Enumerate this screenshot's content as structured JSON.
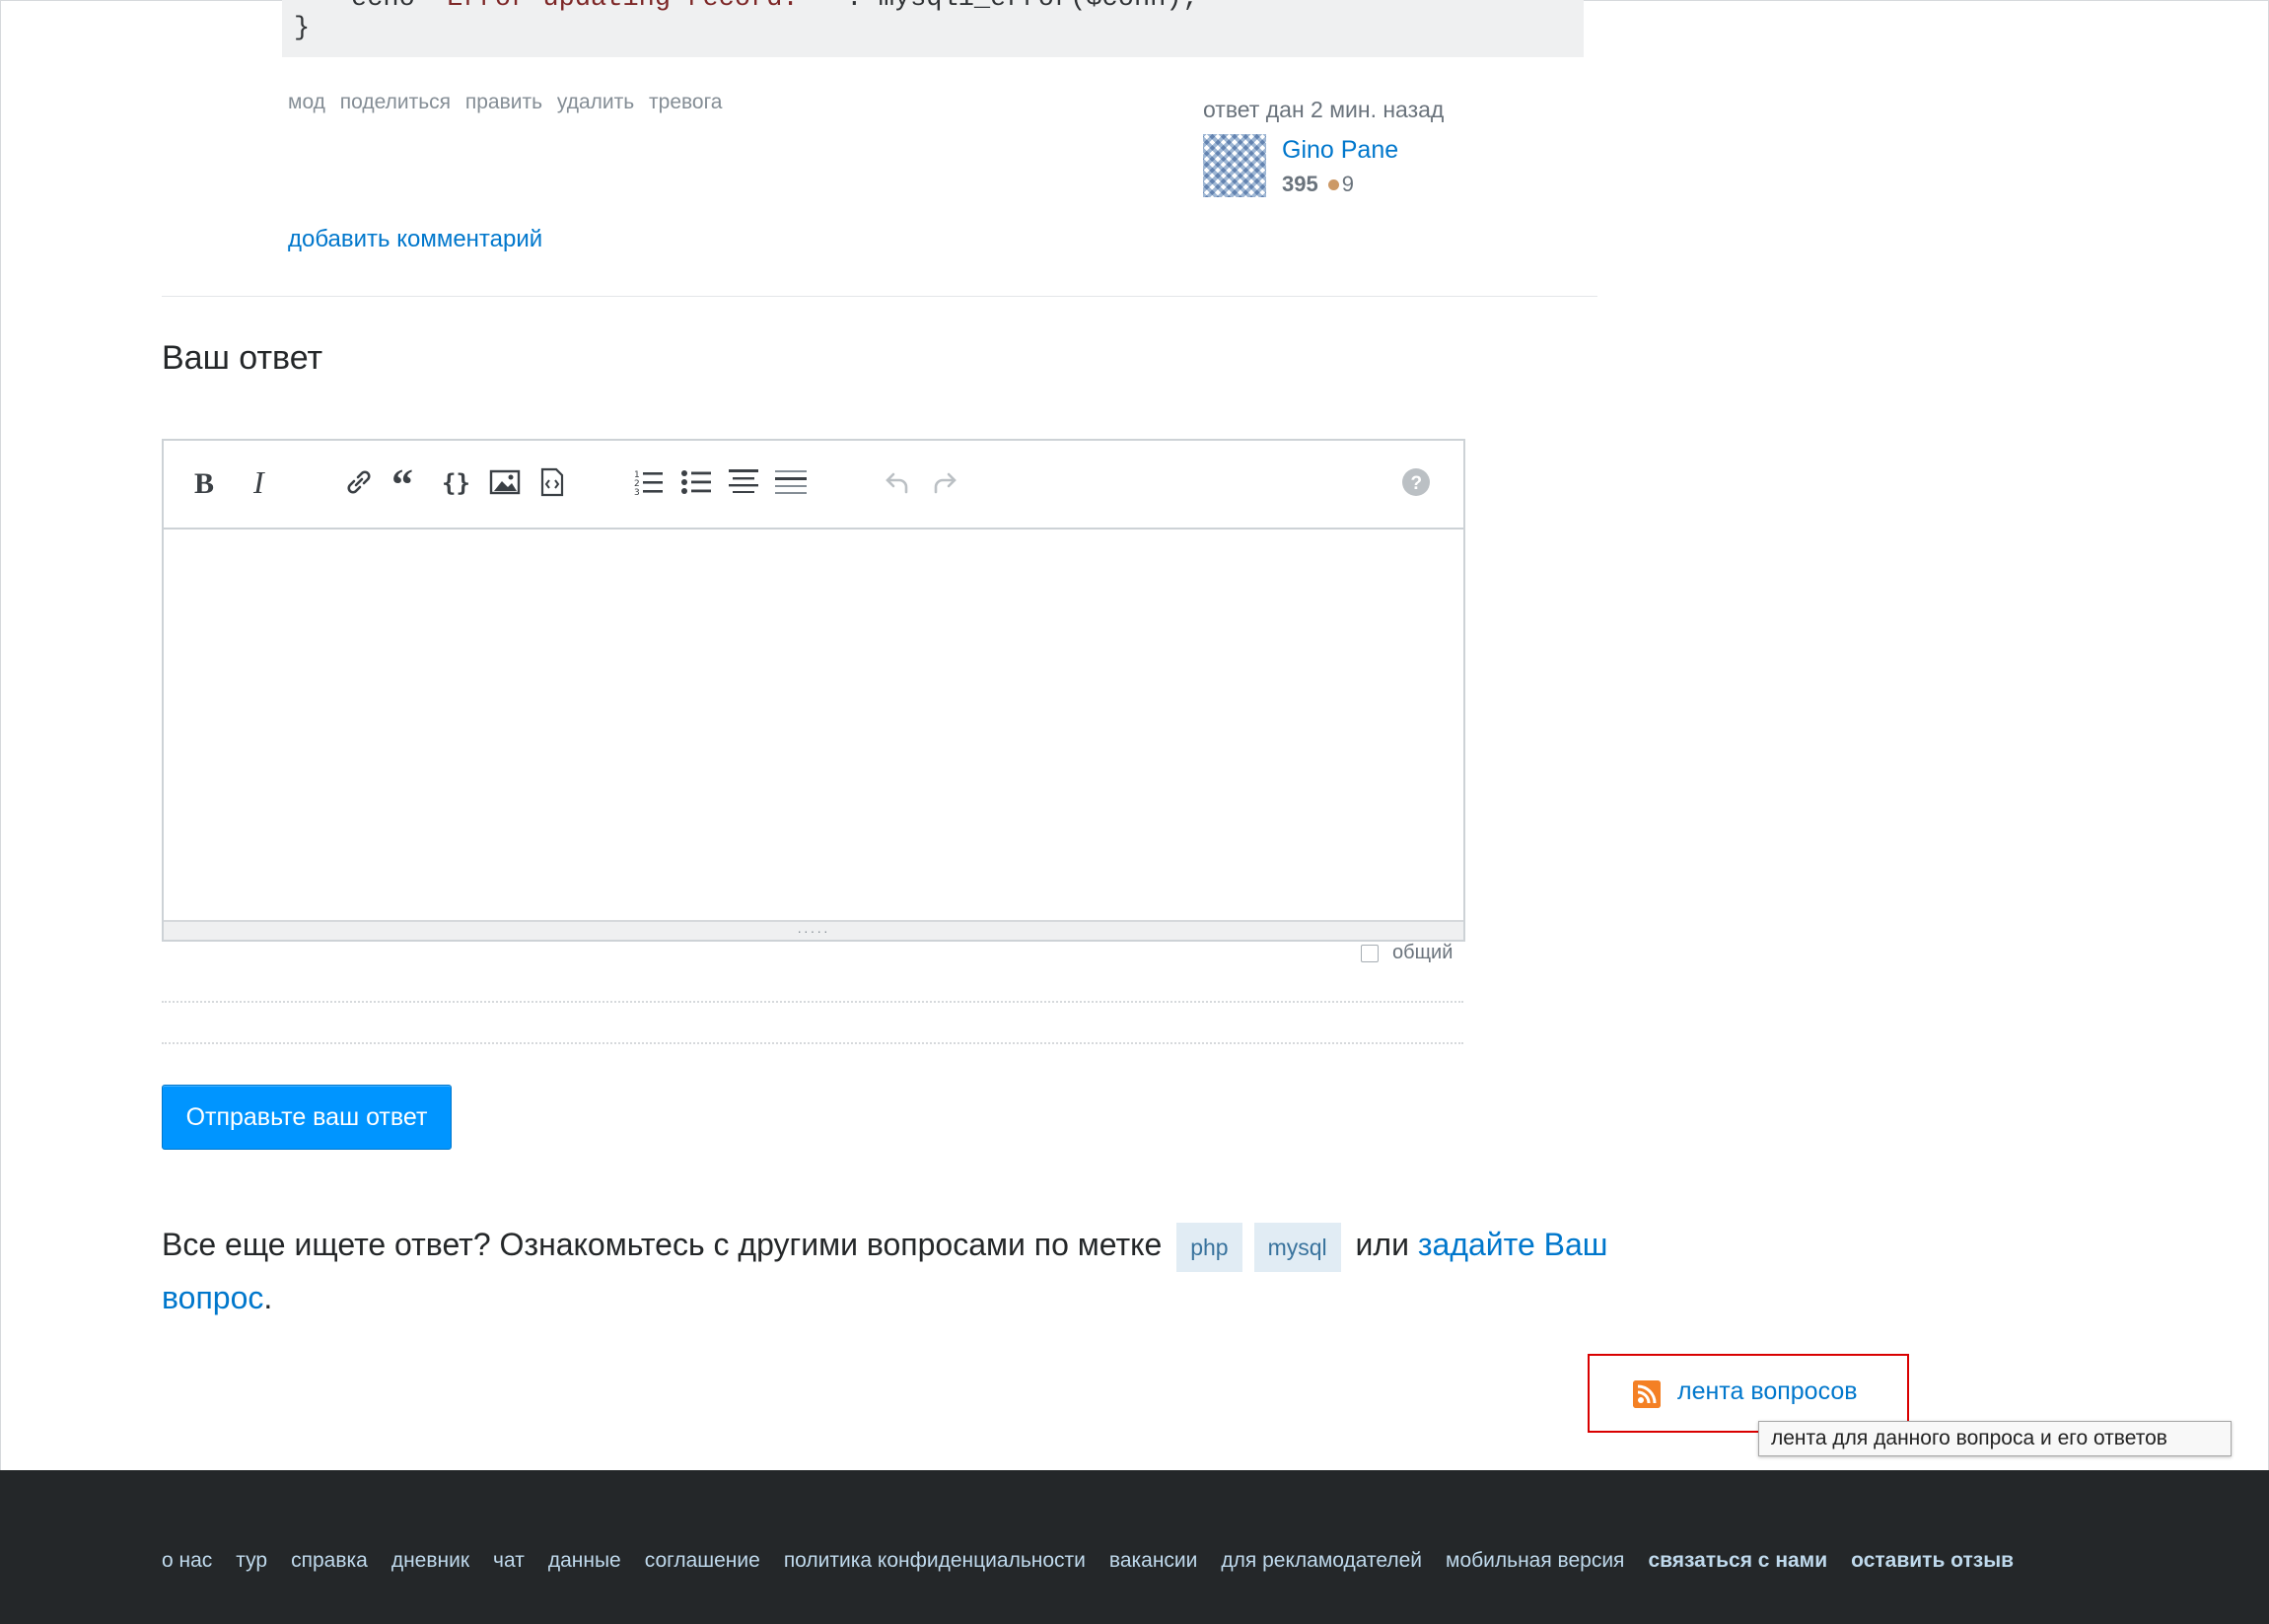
{
  "code": {
    "line1_prefix": "echo ",
    "line1_string": "\"Error updating record: \"",
    "line1_suffix": " . mysqli_error($conn);",
    "line2": "}"
  },
  "post_menu": [
    "мод",
    "поделиться",
    "править",
    "удалить",
    "тревога"
  ],
  "answer_meta": {
    "answered_label": "ответ дан 2 мин. назад",
    "user_name": "Gino Pane",
    "reputation": "395",
    "bronze_badges": "9"
  },
  "add_comment": "добавить комментарий",
  "your_answer_heading": "Ваш ответ",
  "editor": {
    "toolbar_icons": [
      "bold-icon",
      "italic-icon",
      "link-icon",
      "blockquote-icon",
      "code-icon",
      "image-icon",
      "snippet-icon",
      "numbered-list-icon",
      "bulleted-list-icon",
      "heading-icon",
      "horizontal-rule-icon",
      "undo-icon",
      "redo-icon",
      "help-icon"
    ],
    "content": "",
    "grip": "·····"
  },
  "community_wiki_label": "общий",
  "submit_button": "Отправьте ваш ответ",
  "still_looking": {
    "prefix": "Все еще ищете ответ? Ознакомьтесь с другими вопросами по метке",
    "tags": [
      "php",
      "mysql"
    ],
    "or": "или",
    "ask_link": "задайте Ваш вопрос",
    "period": "."
  },
  "feed": {
    "label": "лента вопросов",
    "tooltip": "лента для данного вопроса и его ответов",
    "highlight_color": "#d90000"
  },
  "footer": {
    "links": [
      "о нас",
      "тур",
      "справка",
      "дневник",
      "чат",
      "данные",
      "соглашение",
      "политика конфиденциальности",
      "вакансии",
      "для рекламодателей",
      "мобильная версия"
    ],
    "bold_links": [
      "связаться с нами",
      "оставить отзыв"
    ]
  },
  "colors": {
    "link": "#0077cc",
    "button": "#0095ff",
    "footer_bg": "#242729",
    "tag_bg": "#e1ecf4",
    "rss": "#f48024"
  }
}
